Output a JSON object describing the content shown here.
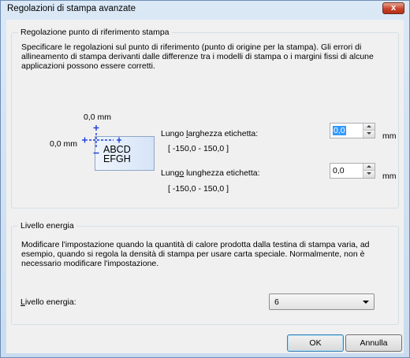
{
  "window": {
    "title": "Regolazioni di stampa avanzate",
    "close": "x"
  },
  "reference_group": {
    "title": "Regolazione punto di riferimento stampa",
    "description": "Specificare le regolazioni sul punto di riferimento (punto di origine per la stampa). Gli errori di allineamento di stampa derivanti dalle differenze tra i modelli di stampa o i margini fissi di alcune applicazioni possono essere corretti.",
    "preview": {
      "top_value": "0,0 mm",
      "left_value": "0,0 mm",
      "sample_line1": "ABCD",
      "sample_line2": "EFGH"
    },
    "width_field": {
      "label_prefix": "Lungo ",
      "label_accel": "l",
      "label_suffix": "arghezza etichetta:",
      "range": "[ -150,0 - 150,0 ]",
      "value": "0,0",
      "unit": "mm"
    },
    "length_field": {
      "label_prefix": "Lung",
      "label_accel": "o",
      "label_suffix": " lunghezza etichetta:",
      "range": "[ -150,0 - 150,0 ]",
      "value": "0,0",
      "unit": "mm"
    }
  },
  "energy_group": {
    "title": "Livello energia",
    "description": "Modificare l'impostazione quando la quantità di calore prodotta dalla testina di stampa varia, ad esempio, quando si regola la densità di stampa per usare carta speciale. Normalmente, non è necessario modificare l'impostazione.",
    "label_accel": "L",
    "label_rest": "ivello energia:",
    "selected": "6"
  },
  "buttons": {
    "ok": "OK",
    "cancel": "Annulla"
  }
}
